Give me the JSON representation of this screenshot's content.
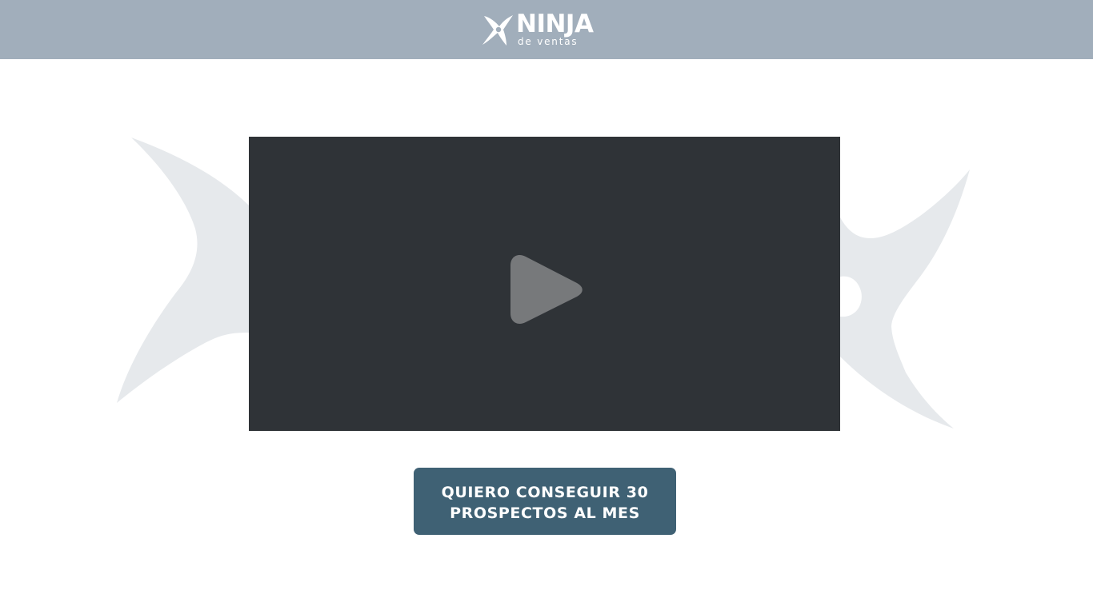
{
  "header": {
    "logo_word": "NINJA",
    "logo_sub": "de ventas",
    "background_color": "#a1aebb"
  },
  "video": {
    "icon": "play-icon",
    "background_color": "#2f3337"
  },
  "background_decoration": {
    "icon": "shuriken-icon",
    "color": "#e6e9ec"
  },
  "cta": {
    "line1": "QUIERO CONSEGUIR 30",
    "line2": "PROSPECTOS AL MES",
    "color": "#3f6174"
  }
}
